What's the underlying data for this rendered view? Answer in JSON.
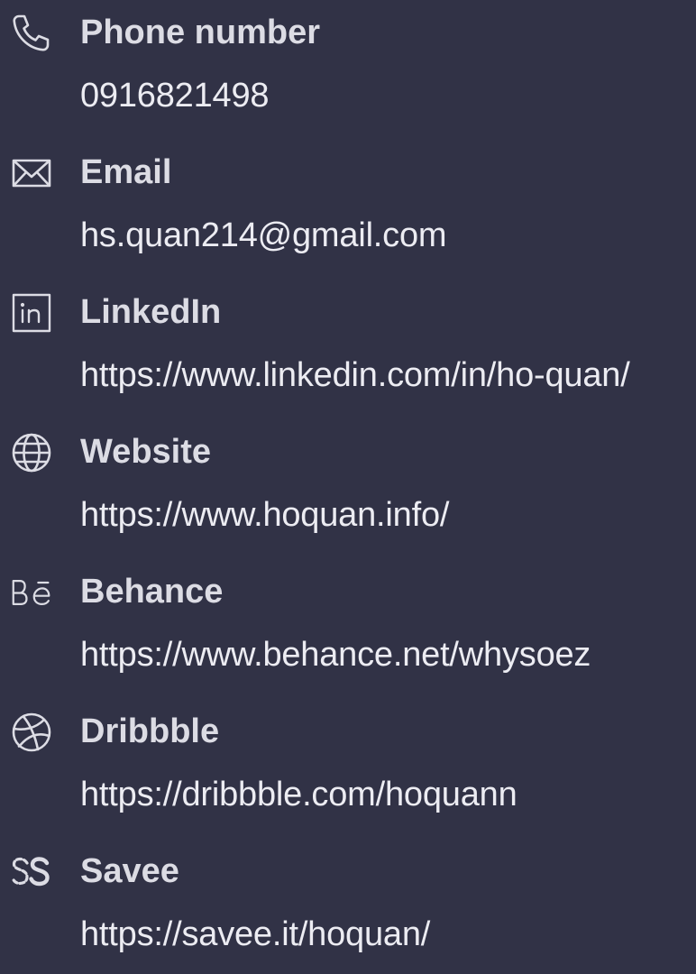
{
  "colors": {
    "background": "#313246",
    "label": "#dcdce4",
    "value": "#ececf2"
  },
  "contacts": [
    {
      "icon": "phone-icon",
      "label": "Phone number",
      "value": "0916821498"
    },
    {
      "icon": "mail-icon",
      "label": "Email",
      "value": "hs.quan214@gmail.com"
    },
    {
      "icon": "linkedin-icon",
      "label": "LinkedIn",
      "value": "https://www.linkedin.com/in/ho-quan/"
    },
    {
      "icon": "globe-icon",
      "label": "Website",
      "value": "https://www.hoquan.info/"
    },
    {
      "icon": "behance-icon",
      "label": "Behance",
      "value": "https://www.behance.net/whysoez"
    },
    {
      "icon": "dribbble-icon",
      "label": "Dribbble",
      "value": "https://dribbble.com/hoquann"
    },
    {
      "icon": "savee-icon",
      "label": "Savee",
      "value": "https://savee.it/hoquan/"
    }
  ]
}
